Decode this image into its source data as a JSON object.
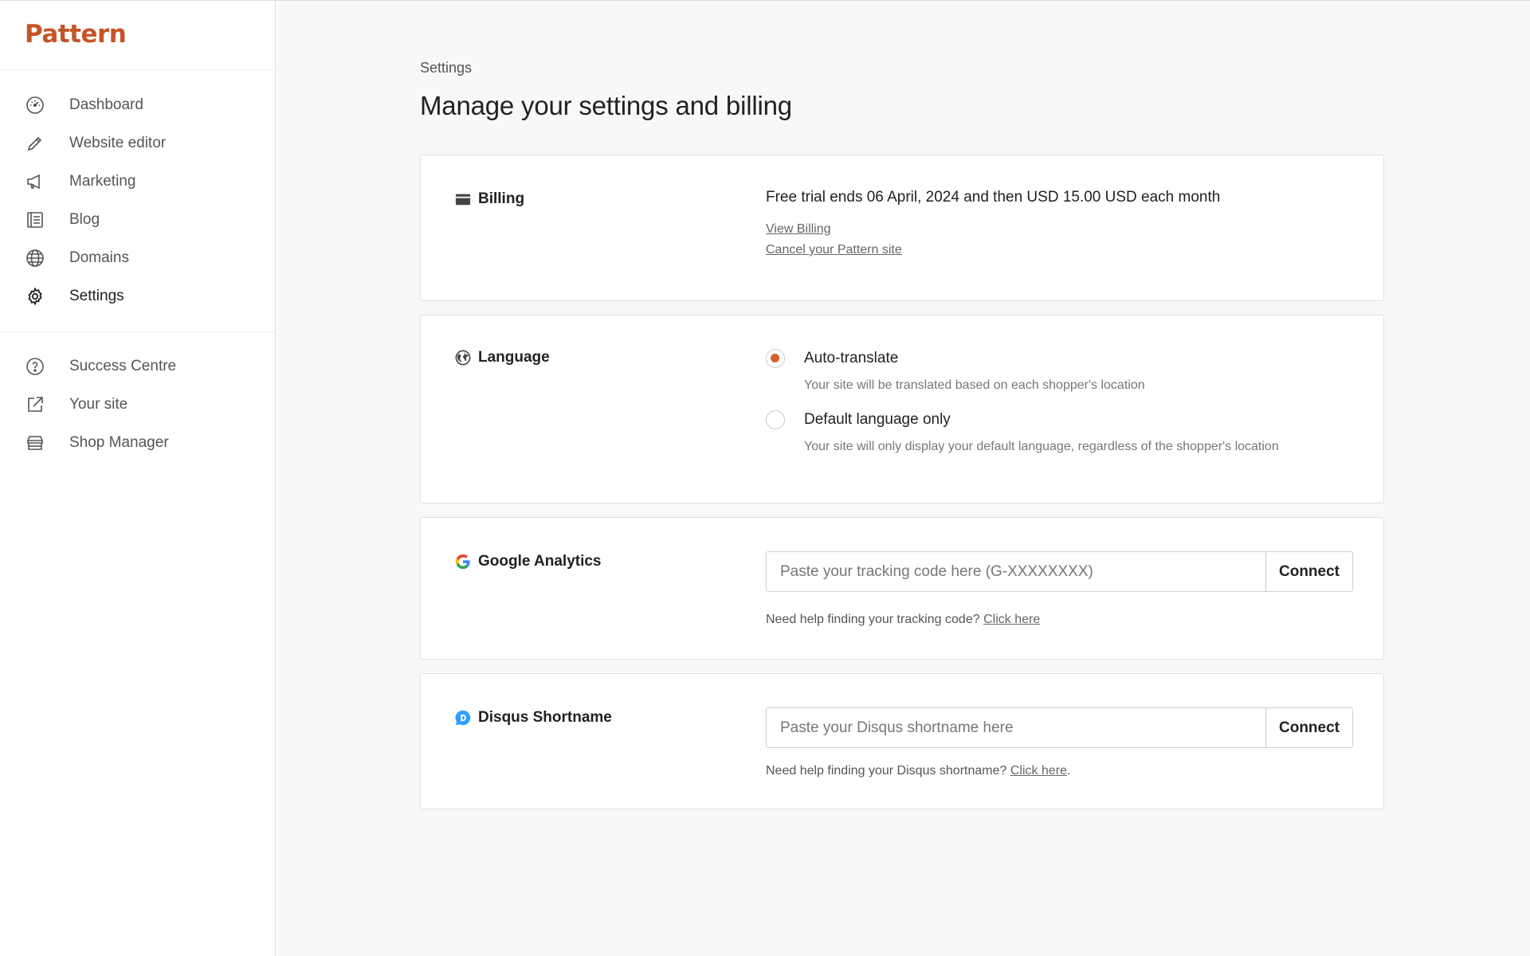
{
  "brand": {
    "name": "Pattern",
    "color": "#c45427"
  },
  "sidebar": {
    "primary": [
      {
        "label": "Dashboard",
        "icon": "dashboard-gauge-icon"
      },
      {
        "label": "Website editor",
        "icon": "pencil-icon"
      },
      {
        "label": "Marketing",
        "icon": "megaphone-icon"
      },
      {
        "label": "Blog",
        "icon": "blog-document-icon"
      },
      {
        "label": "Domains",
        "icon": "globe-icon"
      },
      {
        "label": "Settings",
        "icon": "gear-icon",
        "active": true
      }
    ],
    "secondary": [
      {
        "label": "Success Centre",
        "icon": "help-circle-icon"
      },
      {
        "label": "Your site",
        "icon": "external-link-icon"
      },
      {
        "label": "Shop Manager",
        "icon": "storefront-icon"
      }
    ]
  },
  "page": {
    "breadcrumb": "Settings",
    "title": "Manage your settings and billing"
  },
  "billing": {
    "title": "Billing",
    "text": "Free trial ends 06 April, 2024 and then USD 15.00 USD each month",
    "view_billing": "View Billing",
    "cancel_site": "Cancel your Pattern site"
  },
  "language": {
    "title": "Language",
    "options": [
      {
        "label": "Auto-translate",
        "description": "Your site will be translated based on each shopper's location",
        "selected": true
      },
      {
        "label": "Default language only",
        "description": "Your site will only display your default language, regardless of the shopper's location",
        "selected": false
      }
    ]
  },
  "google_analytics": {
    "title": "Google Analytics",
    "placeholder": "Paste your tracking code here (G-XXXXXXXX)",
    "button": "Connect",
    "help_text": "Need help finding your tracking code?",
    "help_link": "Click here"
  },
  "disqus": {
    "title": "Disqus Shortname",
    "placeholder": "Paste your Disqus shortname here",
    "button": "Connect",
    "help_text": "Need help finding your Disqus shortname?",
    "help_link": "Click here",
    "help_suffix": "."
  },
  "colors": {
    "accent": "#d3612d",
    "disqus_blue": "#2e9fff"
  }
}
